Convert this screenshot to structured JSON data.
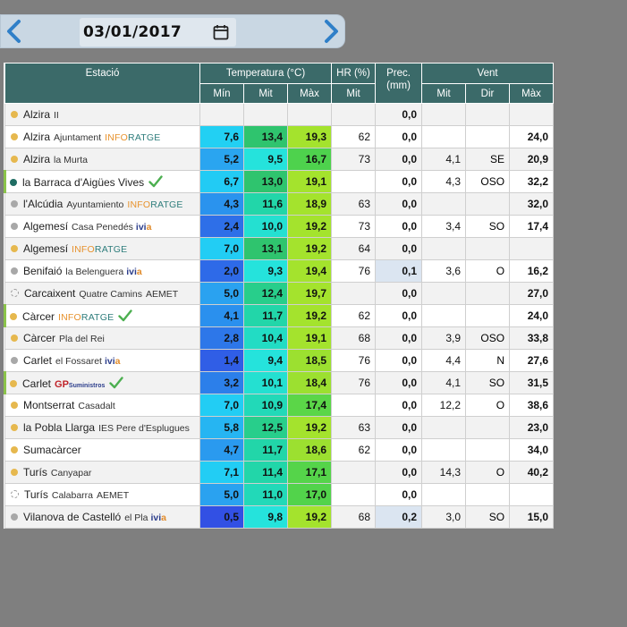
{
  "date": "03/01/2017",
  "icons": {
    "prev": "chevron-left-icon",
    "next": "chevron-right-icon",
    "calendar": "calendar-icon",
    "check": "check-icon"
  },
  "colors": {
    "header_bg": "#3b6a69",
    "dot_yellow": "#e6b84e",
    "dot_gray": "#a8a8a8",
    "dot_teal": "#1f6d63",
    "check": "#4caf50",
    "prec_highlight": "#dbe5f1"
  },
  "header": {
    "station": "Estació",
    "temperature": "Temperatura (°C)",
    "humidity": "HR (%)",
    "precip": "Prec.\n(mm)",
    "wind": "Vent",
    "t_min": "Mín",
    "t_mit": "Mit",
    "t_max": "Màx",
    "hr_mit": "Mit",
    "w_mit": "Mit",
    "w_dir": "Dir",
    "w_max": "Màx"
  },
  "rows": [
    {
      "dot": "yellow",
      "name": "Alzira",
      "sub": "II",
      "net": "",
      "check": false,
      "tmin": "",
      "tmit": "",
      "tmax": "",
      "hr": "",
      "prec": "0,0",
      "wmit": "",
      "wdir": "",
      "wmax": "",
      "tmin_c": "",
      "tmit_c": "",
      "tmax_c": "",
      "prec_hl": false
    },
    {
      "dot": "yellow",
      "name": "Alzira",
      "sub": "Ajuntament",
      "net": "inforatge",
      "check": false,
      "tmin": "7,6",
      "tmit": "13,4",
      "tmax": "19,3",
      "hr": "62",
      "prec": "0,0",
      "wmit": "",
      "wdir": "",
      "wmax": "24,0",
      "tmin_c": "#22d0f3",
      "tmit_c": "#2fc46e",
      "tmax_c": "#a4e32d",
      "prec_hl": false
    },
    {
      "dot": "yellow",
      "name": "Alzira",
      "sub": "la Murta",
      "net": "",
      "check": false,
      "tmin": "5,2",
      "tmit": "9,5",
      "tmax": "16,7",
      "hr": "73",
      "prec": "0,0",
      "wmit": "4,1",
      "wdir": "SE",
      "wmax": "20,9",
      "tmin_c": "#2aa5f0",
      "tmit_c": "#25e3dc",
      "tmax_c": "#4ed24d",
      "prec_hl": false
    },
    {
      "dot": "teal",
      "name": "la Barraca d'Aigües Vives",
      "sub": "",
      "net": "",
      "check": true,
      "tmin": "6,7",
      "tmit": "13,0",
      "tmax": "19,1",
      "hr": "",
      "prec": "0,0",
      "wmit": "4,3",
      "wdir": "OSO",
      "wmax": "32,2",
      "tmin_c": "#22cbf4",
      "tmit_c": "#2fc46e",
      "tmax_c": "#a4e32d",
      "prec_hl": false
    },
    {
      "dot": "gray",
      "name": "l'Alcúdia",
      "sub": "Ayuntamiento",
      "net": "inforatge",
      "check": false,
      "tmin": "4,3",
      "tmit": "11,6",
      "tmax": "18,9",
      "hr": "63",
      "prec": "0,0",
      "wmit": "",
      "wdir": "",
      "wmax": "32,0",
      "tmin_c": "#2a93ee",
      "tmit_c": "#22d6a9",
      "tmax_c": "#a4e32d",
      "prec_hl": false
    },
    {
      "dot": "gray",
      "name": "Algemesí",
      "sub": "Casa Penedés",
      "net": "ivia",
      "check": false,
      "tmin": "2,4",
      "tmit": "10,0",
      "tmax": "19,2",
      "hr": "73",
      "prec": "0,0",
      "wmit": "3,4",
      "wdir": "SO",
      "wmax": "17,4",
      "tmin_c": "#2e6fe8",
      "tmit_c": "#24e0d1",
      "tmax_c": "#a4e32d",
      "prec_hl": false
    },
    {
      "dot": "yellow",
      "name": "Algemesí",
      "sub": "",
      "net": "inforatge",
      "check": false,
      "tmin": "7,0",
      "tmit": "13,1",
      "tmax": "19,2",
      "hr": "64",
      "prec": "0,0",
      "wmit": "",
      "wdir": "",
      "wmax": "",
      "tmin_c": "#22cdf4",
      "tmit_c": "#2fc46e",
      "tmax_c": "#a4e32d",
      "prec_hl": false
    },
    {
      "dot": "gray",
      "name": "Benifaió",
      "sub": "la Belenguera",
      "net": "ivia",
      "check": false,
      "tmin": "2,0",
      "tmit": "9,3",
      "tmax": "19,4",
      "hr": "76",
      "prec": "0,1",
      "wmit": "3,6",
      "wdir": "O",
      "wmax": "16,2",
      "tmin_c": "#2e6ae8",
      "tmit_c": "#25e3dc",
      "tmax_c": "#a4e32d",
      "prec_hl": true
    },
    {
      "dot": "hollow",
      "name": "Carcaixent",
      "sub": "Quatre Camins",
      "net": "aemet",
      "check": false,
      "tmin": "5,0",
      "tmit": "12,4",
      "tmax": "19,7",
      "hr": "",
      "prec": "0,0",
      "wmit": "",
      "wdir": "",
      "wmax": "27,0",
      "tmin_c": "#2aa2f0",
      "tmit_c": "#28ce8b",
      "tmax_c": "#a4e32d",
      "prec_hl": false
    },
    {
      "dot": "yellow",
      "name": "Càrcer",
      "sub": "",
      "net": "inforatge",
      "check": true,
      "tmin": "4,1",
      "tmit": "11,7",
      "tmax": "19,2",
      "hr": "62",
      "prec": "0,0",
      "wmit": "",
      "wdir": "",
      "wmax": "24,0",
      "tmin_c": "#2a90ee",
      "tmit_c": "#22d6a9",
      "tmax_c": "#a4e32d",
      "prec_hl": false
    },
    {
      "dot": "yellow",
      "name": "Càrcer",
      "sub": "Pla del Rei",
      "net": "",
      "check": false,
      "tmin": "2,8",
      "tmit": "10,4",
      "tmax": "19,1",
      "hr": "68",
      "prec": "0,0",
      "wmit": "3,9",
      "wdir": "OSO",
      "wmax": "33,8",
      "tmin_c": "#2d77e9",
      "tmit_c": "#22dcc4",
      "tmax_c": "#a4e32d",
      "prec_hl": false
    },
    {
      "dot": "gray",
      "name": "Carlet",
      "sub": "el Fossaret",
      "net": "ivia",
      "check": false,
      "tmin": "1,4",
      "tmit": "9,4",
      "tmax": "18,5",
      "hr": "76",
      "prec": "0,0",
      "wmit": "4,4",
      "wdir": "N",
      "wmax": "27,6",
      "tmin_c": "#305ee6",
      "tmit_c": "#25e3dc",
      "tmax_c": "#9ce030",
      "prec_hl": false
    },
    {
      "dot": "yellow",
      "name": "Carlet",
      "sub": "",
      "net": "gp",
      "check": true,
      "tmin": "3,2",
      "tmit": "10,1",
      "tmax": "18,4",
      "hr": "76",
      "prec": "0,0",
      "wmit": "4,1",
      "wdir": "SO",
      "wmax": "31,5",
      "tmin_c": "#2c7fea",
      "tmit_c": "#24e0d1",
      "tmax_c": "#9ce030",
      "prec_hl": false
    },
    {
      "dot": "yellow",
      "name": "Montserrat",
      "sub": "Casadalt",
      "net": "",
      "check": false,
      "tmin": "7,0",
      "tmit": "10,9",
      "tmax": "17,4",
      "hr": "",
      "prec": "0,0",
      "wmit": "12,2",
      "wdir": "O",
      "wmax": "38,6",
      "tmin_c": "#22cdf4",
      "tmit_c": "#22d9b8",
      "tmax_c": "#5bd648",
      "prec_hl": false
    },
    {
      "dot": "yellow",
      "name": "la Pobla Llarga",
      "sub": "IES Pere d'Esplugues",
      "net": "",
      "check": false,
      "tmin": "5,8",
      "tmit": "12,5",
      "tmax": "19,2",
      "hr": "63",
      "prec": "0,0",
      "wmit": "",
      "wdir": "",
      "wmax": "23,0",
      "tmin_c": "#26b5f2",
      "tmit_c": "#28ce8b",
      "tmax_c": "#a4e32d",
      "prec_hl": false
    },
    {
      "dot": "yellow",
      "name": "Sumacàrcer",
      "sub": "",
      "net": "",
      "check": false,
      "tmin": "4,7",
      "tmit": "11,7",
      "tmax": "18,6",
      "hr": "62",
      "prec": "0,0",
      "wmit": "",
      "wdir": "",
      "wmax": "34,0",
      "tmin_c": "#2a9aef",
      "tmit_c": "#22d6a9",
      "tmax_c": "#9ce030",
      "prec_hl": false
    },
    {
      "dot": "yellow",
      "name": "Turís",
      "sub": "Canyapar",
      "net": "",
      "check": false,
      "tmin": "7,1",
      "tmit": "11,4",
      "tmax": "17,1",
      "hr": "",
      "prec": "0,0",
      "wmit": "14,3",
      "wdir": "O",
      "wmax": "40,2",
      "tmin_c": "#22cdf4",
      "tmit_c": "#22d6a9",
      "tmax_c": "#55d44a",
      "prec_hl": false
    },
    {
      "dot": "hollow",
      "name": "Turís",
      "sub": "Calabarra",
      "net": "aemet",
      "check": false,
      "tmin": "5,0",
      "tmit": "11,0",
      "tmax": "17,0",
      "hr": "",
      "prec": "0,0",
      "wmit": "",
      "wdir": "",
      "wmax": "",
      "tmin_c": "#2aa2f0",
      "tmit_c": "#22d9b8",
      "tmax_c": "#52d34b",
      "prec_hl": false
    },
    {
      "dot": "gray",
      "name": "Vilanova de Castelló",
      "sub": "el Pla",
      "net": "ivia",
      "check": false,
      "tmin": "0,5",
      "tmit": "9,8",
      "tmax": "19,2",
      "hr": "68",
      "prec": "0,2",
      "wmit": "3,0",
      "wdir": "SO",
      "wmax": "15,0",
      "tmin_c": "#3250e4",
      "tmit_c": "#25e3dc",
      "tmax_c": "#a4e32d",
      "prec_hl": true
    }
  ]
}
